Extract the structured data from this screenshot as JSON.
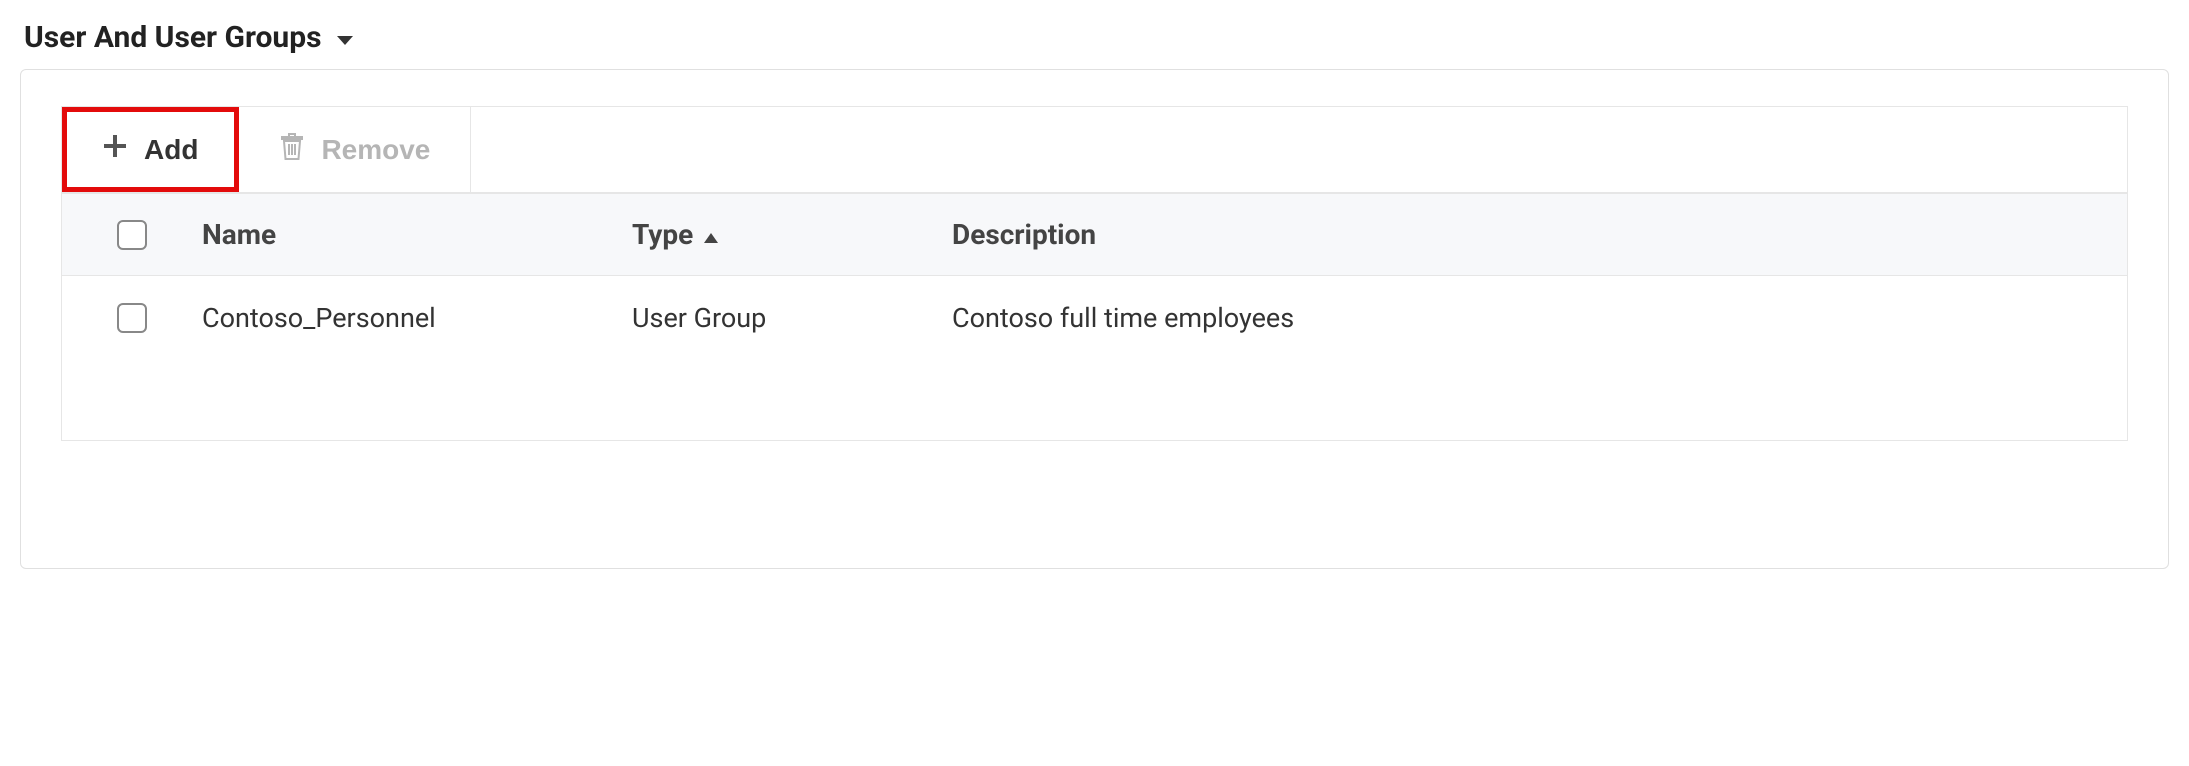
{
  "section": {
    "title": "User And User Groups"
  },
  "toolbar": {
    "add_label": "Add",
    "remove_label": "Remove"
  },
  "table": {
    "headers": {
      "name": "Name",
      "type": "Type",
      "description": "Description"
    },
    "rows": [
      {
        "name": "Contoso_Personnel",
        "type": "User Group",
        "description": "Contoso full time employees"
      }
    ]
  }
}
